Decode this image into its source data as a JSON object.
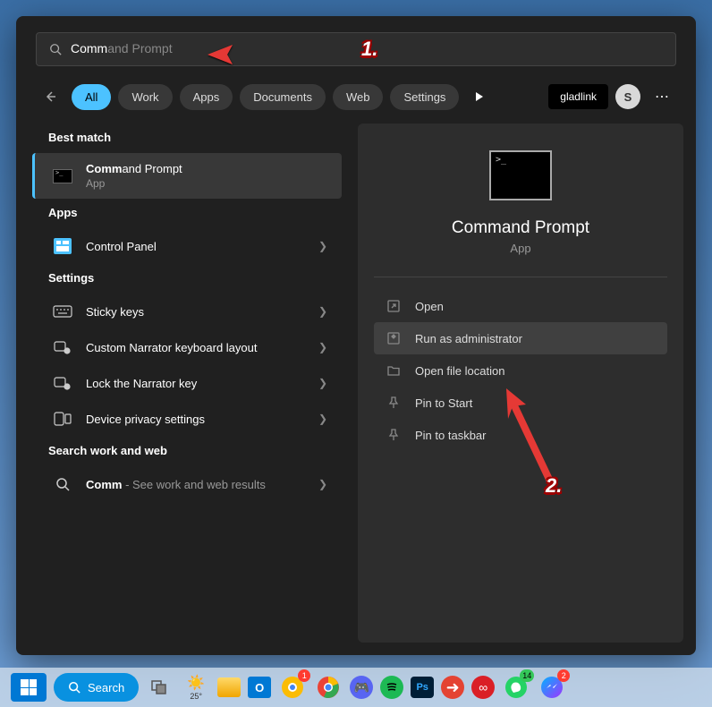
{
  "search": {
    "typed": "Comm",
    "ghost": "and Prompt"
  },
  "tabs": [
    "All",
    "Work",
    "Apps",
    "Documents",
    "Web",
    "Settings"
  ],
  "gladlink": "gladlink",
  "avatar": "S",
  "sections": {
    "best_match": "Best match",
    "apps": "Apps",
    "settings": "Settings",
    "search_web": "Search work and web"
  },
  "best_match_item": {
    "title_bold": "Comm",
    "title_rest": "and Prompt",
    "sub": "App"
  },
  "apps_list": [
    {
      "title": "Control Panel"
    }
  ],
  "settings_list": [
    {
      "title": "Sticky keys"
    },
    {
      "title": "Custom Narrator keyboard layout"
    },
    {
      "title": "Lock the Narrator key"
    },
    {
      "title": "Device privacy settings"
    }
  ],
  "web_item": {
    "title_bold": "Comm",
    "title_rest": " - See work and web results"
  },
  "preview": {
    "title": "Command Prompt",
    "sub": "App"
  },
  "actions": [
    {
      "label": "Open",
      "icon": "open"
    },
    {
      "label": "Run as administrator",
      "icon": "admin",
      "highlighted": true
    },
    {
      "label": "Open file location",
      "icon": "folder"
    },
    {
      "label": "Pin to Start",
      "icon": "pin"
    },
    {
      "label": "Pin to taskbar",
      "icon": "pin"
    }
  ],
  "taskbar": {
    "search": "Search",
    "weather": "25°"
  },
  "annotations": {
    "one": "1.",
    "two": "2."
  }
}
